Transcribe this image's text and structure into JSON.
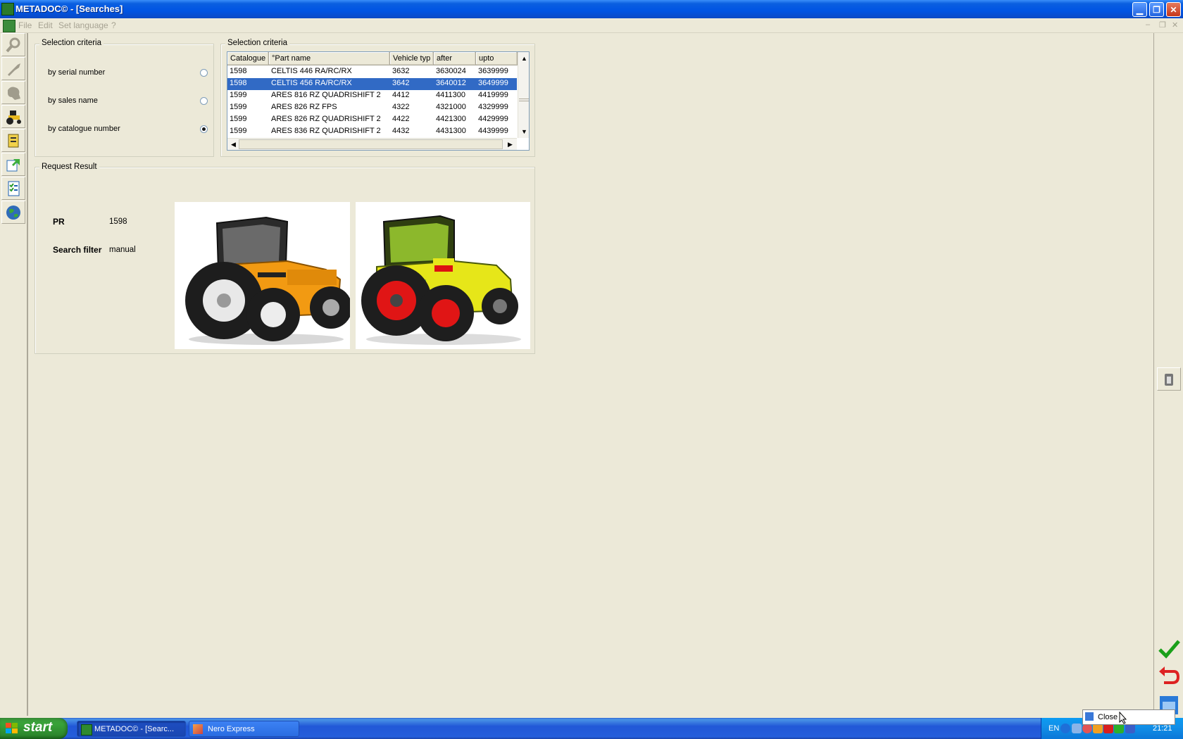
{
  "window": {
    "title": "METADOC© - [Searches]",
    "min_glyph": "▁",
    "restore_glyph": "❐",
    "close_glyph": "✕"
  },
  "menu": {
    "items": [
      "File",
      "Edit",
      "Set language",
      "?"
    ],
    "mdi_controls": [
      "–",
      "❐",
      "✕"
    ]
  },
  "left_toolbar": [
    "search-icon",
    "wrench-icon",
    "engine-icon",
    "tractor-icon",
    "book-icon",
    "export-icon",
    "checklist-icon",
    "globe-icon"
  ],
  "criteria": {
    "title": "Selection criteria",
    "options": [
      {
        "label": "by serial number",
        "selected": false
      },
      {
        "label": "by sales name",
        "selected": false
      },
      {
        "label": "by catalogue number",
        "selected": true
      }
    ]
  },
  "list": {
    "title": "Selection criteria",
    "columns": [
      "Catalogue",
      "°Part name",
      "Vehicle typ",
      "after",
      "upto"
    ],
    "rows": [
      {
        "catalogue": "1598",
        "name": "CELTIS 446 RA/RC/RX",
        "type": "3632",
        "after": "3630024",
        "upto": "3639999",
        "selected": false
      },
      {
        "catalogue": "1598",
        "name": "CELTIS 456 RA/RC/RX",
        "type": "3642",
        "after": "3640012",
        "upto": "3649999",
        "selected": true
      },
      {
        "catalogue": "1599",
        "name": "ARES 816 RZ QUADRISHIFT 2",
        "type": "4412",
        "after": "4411300",
        "upto": "4419999",
        "selected": false
      },
      {
        "catalogue": "1599",
        "name": "ARES 826 RZ FPS",
        "type": "4322",
        "after": "4321000",
        "upto": "4329999",
        "selected": false
      },
      {
        "catalogue": "1599",
        "name": "ARES 826 RZ QUADRISHIFT 2",
        "type": "4422",
        "after": "4421300",
        "upto": "4429999",
        "selected": false
      },
      {
        "catalogue": "1599",
        "name": "ARES 836 RZ QUADRISHIFT 2",
        "type": "4432",
        "after": "4431300",
        "upto": "4439999",
        "selected": false
      }
    ]
  },
  "result": {
    "title": "Request Result",
    "pr_label": "PR",
    "pr_value": "1598",
    "filter_label": "Search filter",
    "filter_value": "manual",
    "images": [
      "renault-tractor-image",
      "claas-tractor-image"
    ]
  },
  "right_toolbar": [
    "info-icon",
    "confirm-check-icon",
    "undo-arrow-icon",
    "window-icon"
  ],
  "taskbar": {
    "start": "start",
    "tasks": [
      "METADOC© - [Searc...",
      "Nero Express"
    ],
    "lang": "EN",
    "clock": "21:21",
    "tooltip": "Close"
  }
}
